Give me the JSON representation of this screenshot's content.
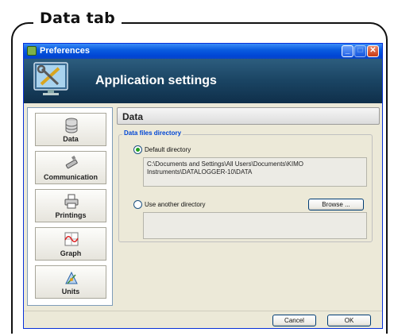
{
  "frame": {
    "title": "Data tab"
  },
  "window": {
    "title": "Preferences",
    "controls": {
      "minimize": "_",
      "maximize": "□",
      "close": "✕"
    }
  },
  "banner": {
    "title": "Application settings",
    "icon": "tools-icon"
  },
  "sidebar": {
    "items": [
      {
        "label": "Data",
        "icon": "database-icon",
        "selected": true
      },
      {
        "label": "Communication",
        "icon": "usb-icon",
        "selected": false
      },
      {
        "label": "Printings",
        "icon": "printer-icon",
        "selected": false
      },
      {
        "label": "Graph",
        "icon": "graph-icon",
        "selected": false
      },
      {
        "label": "Units",
        "icon": "units-icon",
        "selected": false
      }
    ]
  },
  "content": {
    "header": "Data",
    "group_title": "Data files directory",
    "default_option": {
      "label": "Default directory",
      "selected": true
    },
    "default_path_line1": "C:\\Documents and Settings\\All Users\\Documents\\KIMO",
    "default_path_line2": "Instruments\\DATALOGGER-10\\DATA",
    "other_option": {
      "label": "Use another directory",
      "selected": false
    },
    "browse_label": "Browse ...",
    "other_path": ""
  },
  "footer": {
    "cancel_label": "Cancel",
    "ok_label": "OK"
  }
}
